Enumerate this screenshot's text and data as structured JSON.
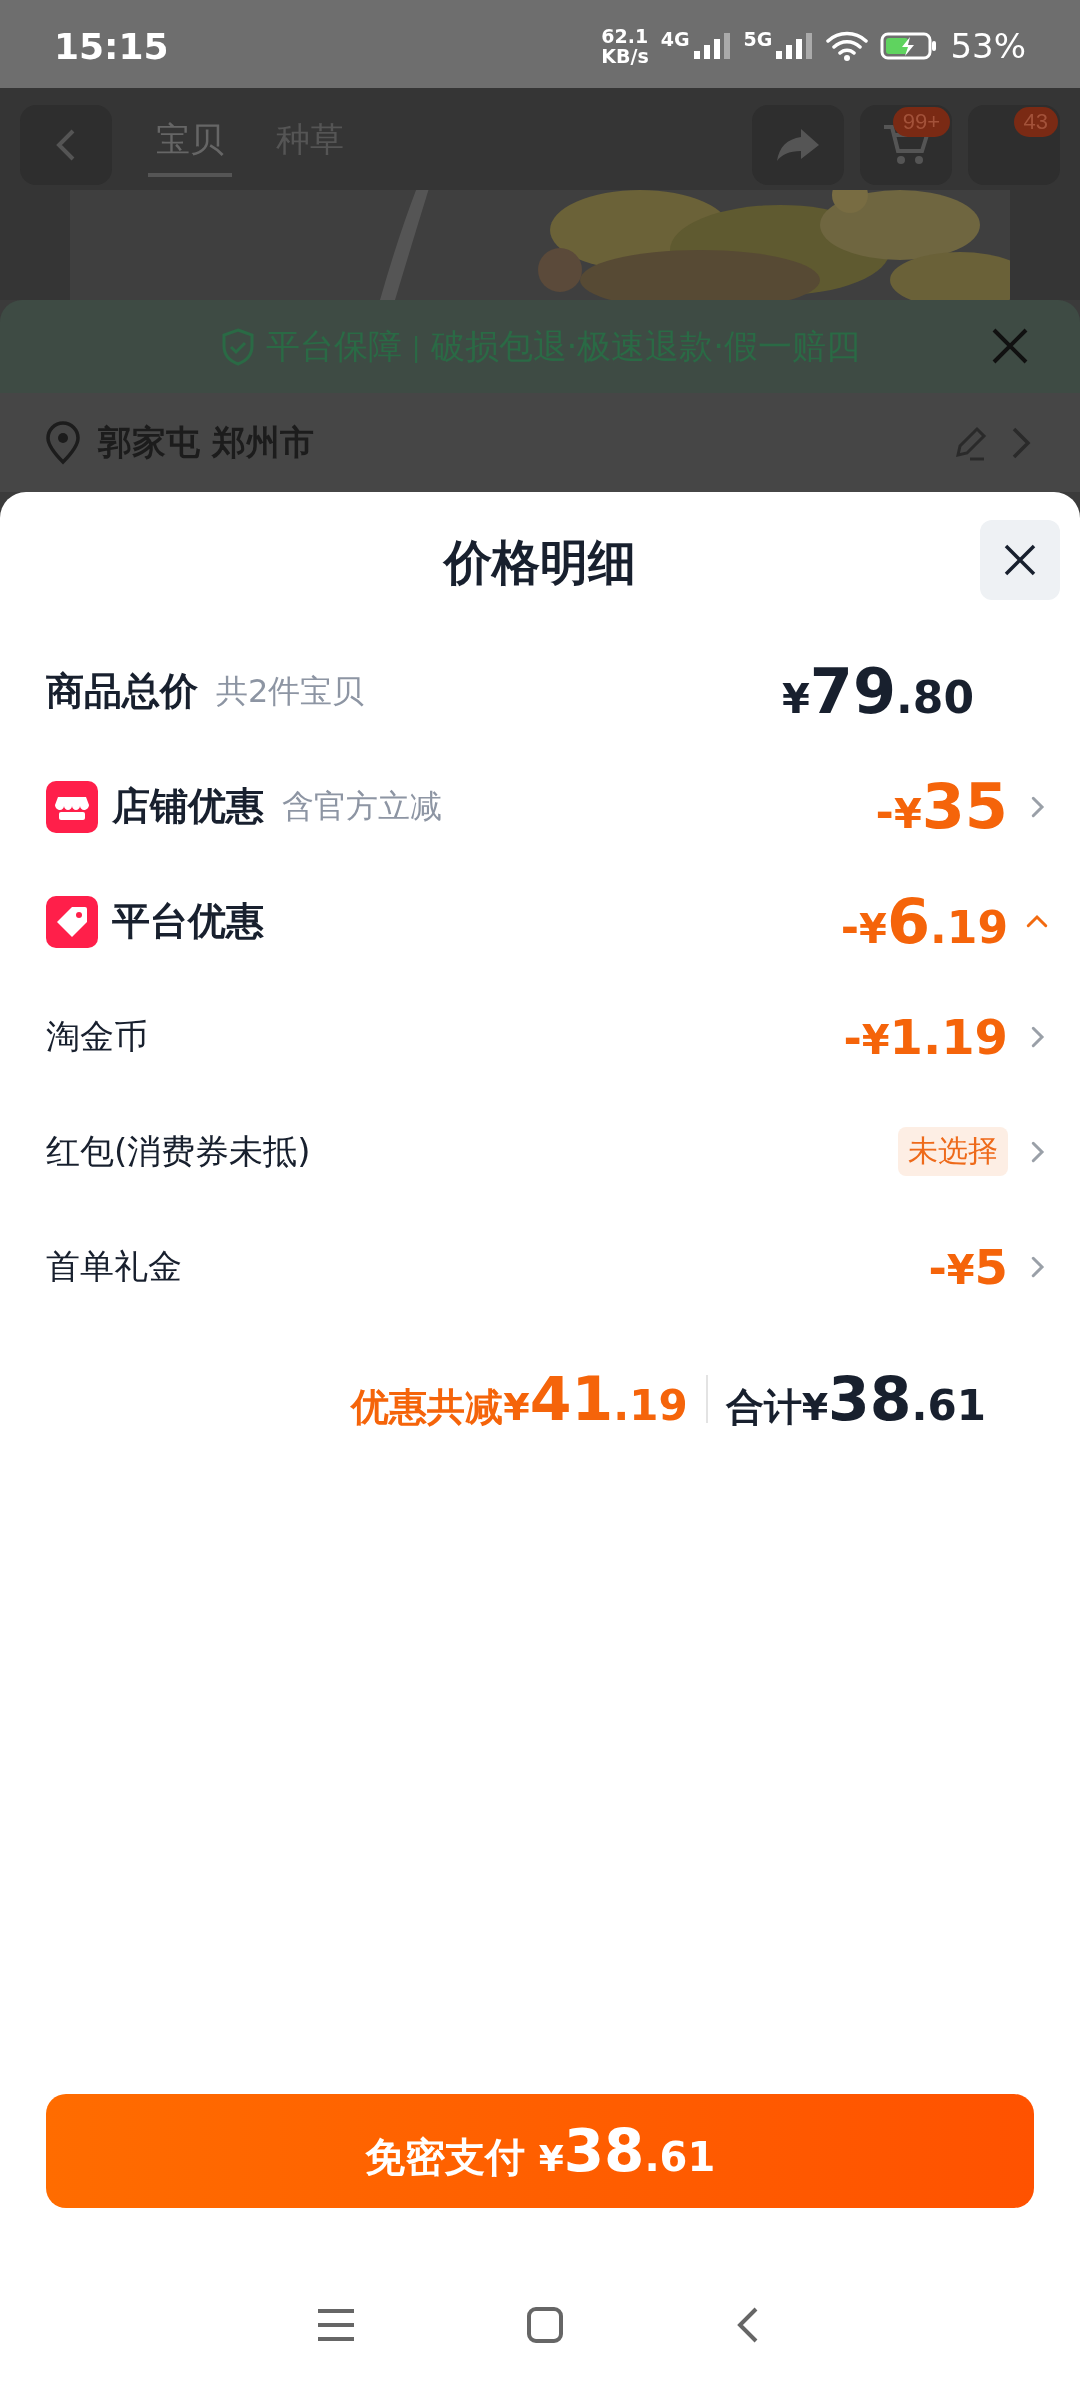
{
  "status_bar": {
    "time": "15:15",
    "speed": "62.1",
    "speed_unit": "KB/s",
    "network_1": "4G",
    "network_2": "5G",
    "battery": "53%"
  },
  "nav_bar": {
    "tabs": [
      {
        "label": "宝贝",
        "selected": true
      },
      {
        "label": "种草",
        "selected": false
      }
    ],
    "cart_badge": "99+",
    "more_badge": "43"
  },
  "guarantee": {
    "title": "平台保障",
    "separator": "|",
    "text": "破损包退·极速退款·假一赔四"
  },
  "address": {
    "text": "郭家屯 郑州市"
  },
  "sheet": {
    "title": "价格明细",
    "goods_total": {
      "label": "商品总价",
      "note": "共2件宝贝",
      "price": {
        "symbol": "¥",
        "integer": "79",
        "decimal": ".80"
      }
    },
    "discounts": [
      {
        "kind": "group",
        "label": "店铺优惠",
        "note": "含官方立减",
        "value": {
          "sign": "-",
          "symbol": "¥",
          "integer": "35"
        },
        "expanded": false
      },
      {
        "kind": "group",
        "label": "平台优惠",
        "value": {
          "sign": "-",
          "symbol": "¥",
          "integer": "6",
          "decimal": ".19"
        },
        "expanded": true
      },
      {
        "kind": "item",
        "label": "淘金币",
        "value": {
          "sign": "-",
          "symbol": "¥",
          "integer": "1.19"
        },
        "expanded": false
      },
      {
        "kind": "item",
        "label": "红包(消费券未抵)",
        "tag": "未选择",
        "expanded": false
      },
      {
        "kind": "item",
        "label": "首单礼金",
        "value": {
          "sign": "-",
          "symbol": "¥",
          "integer": "5"
        },
        "expanded": false
      }
    ],
    "summary": {
      "discount_label": "优惠共减",
      "discount": {
        "symbol": "¥",
        "integer": "41",
        "decimal": ".19"
      },
      "total_label": "合计",
      "total": {
        "symbol": "¥",
        "integer": "38",
        "decimal": ".61"
      }
    },
    "pay_button": {
      "label": "免密支付",
      "price": {
        "symbol": "¥",
        "integer": "38",
        "decimal": ".61"
      }
    }
  }
}
